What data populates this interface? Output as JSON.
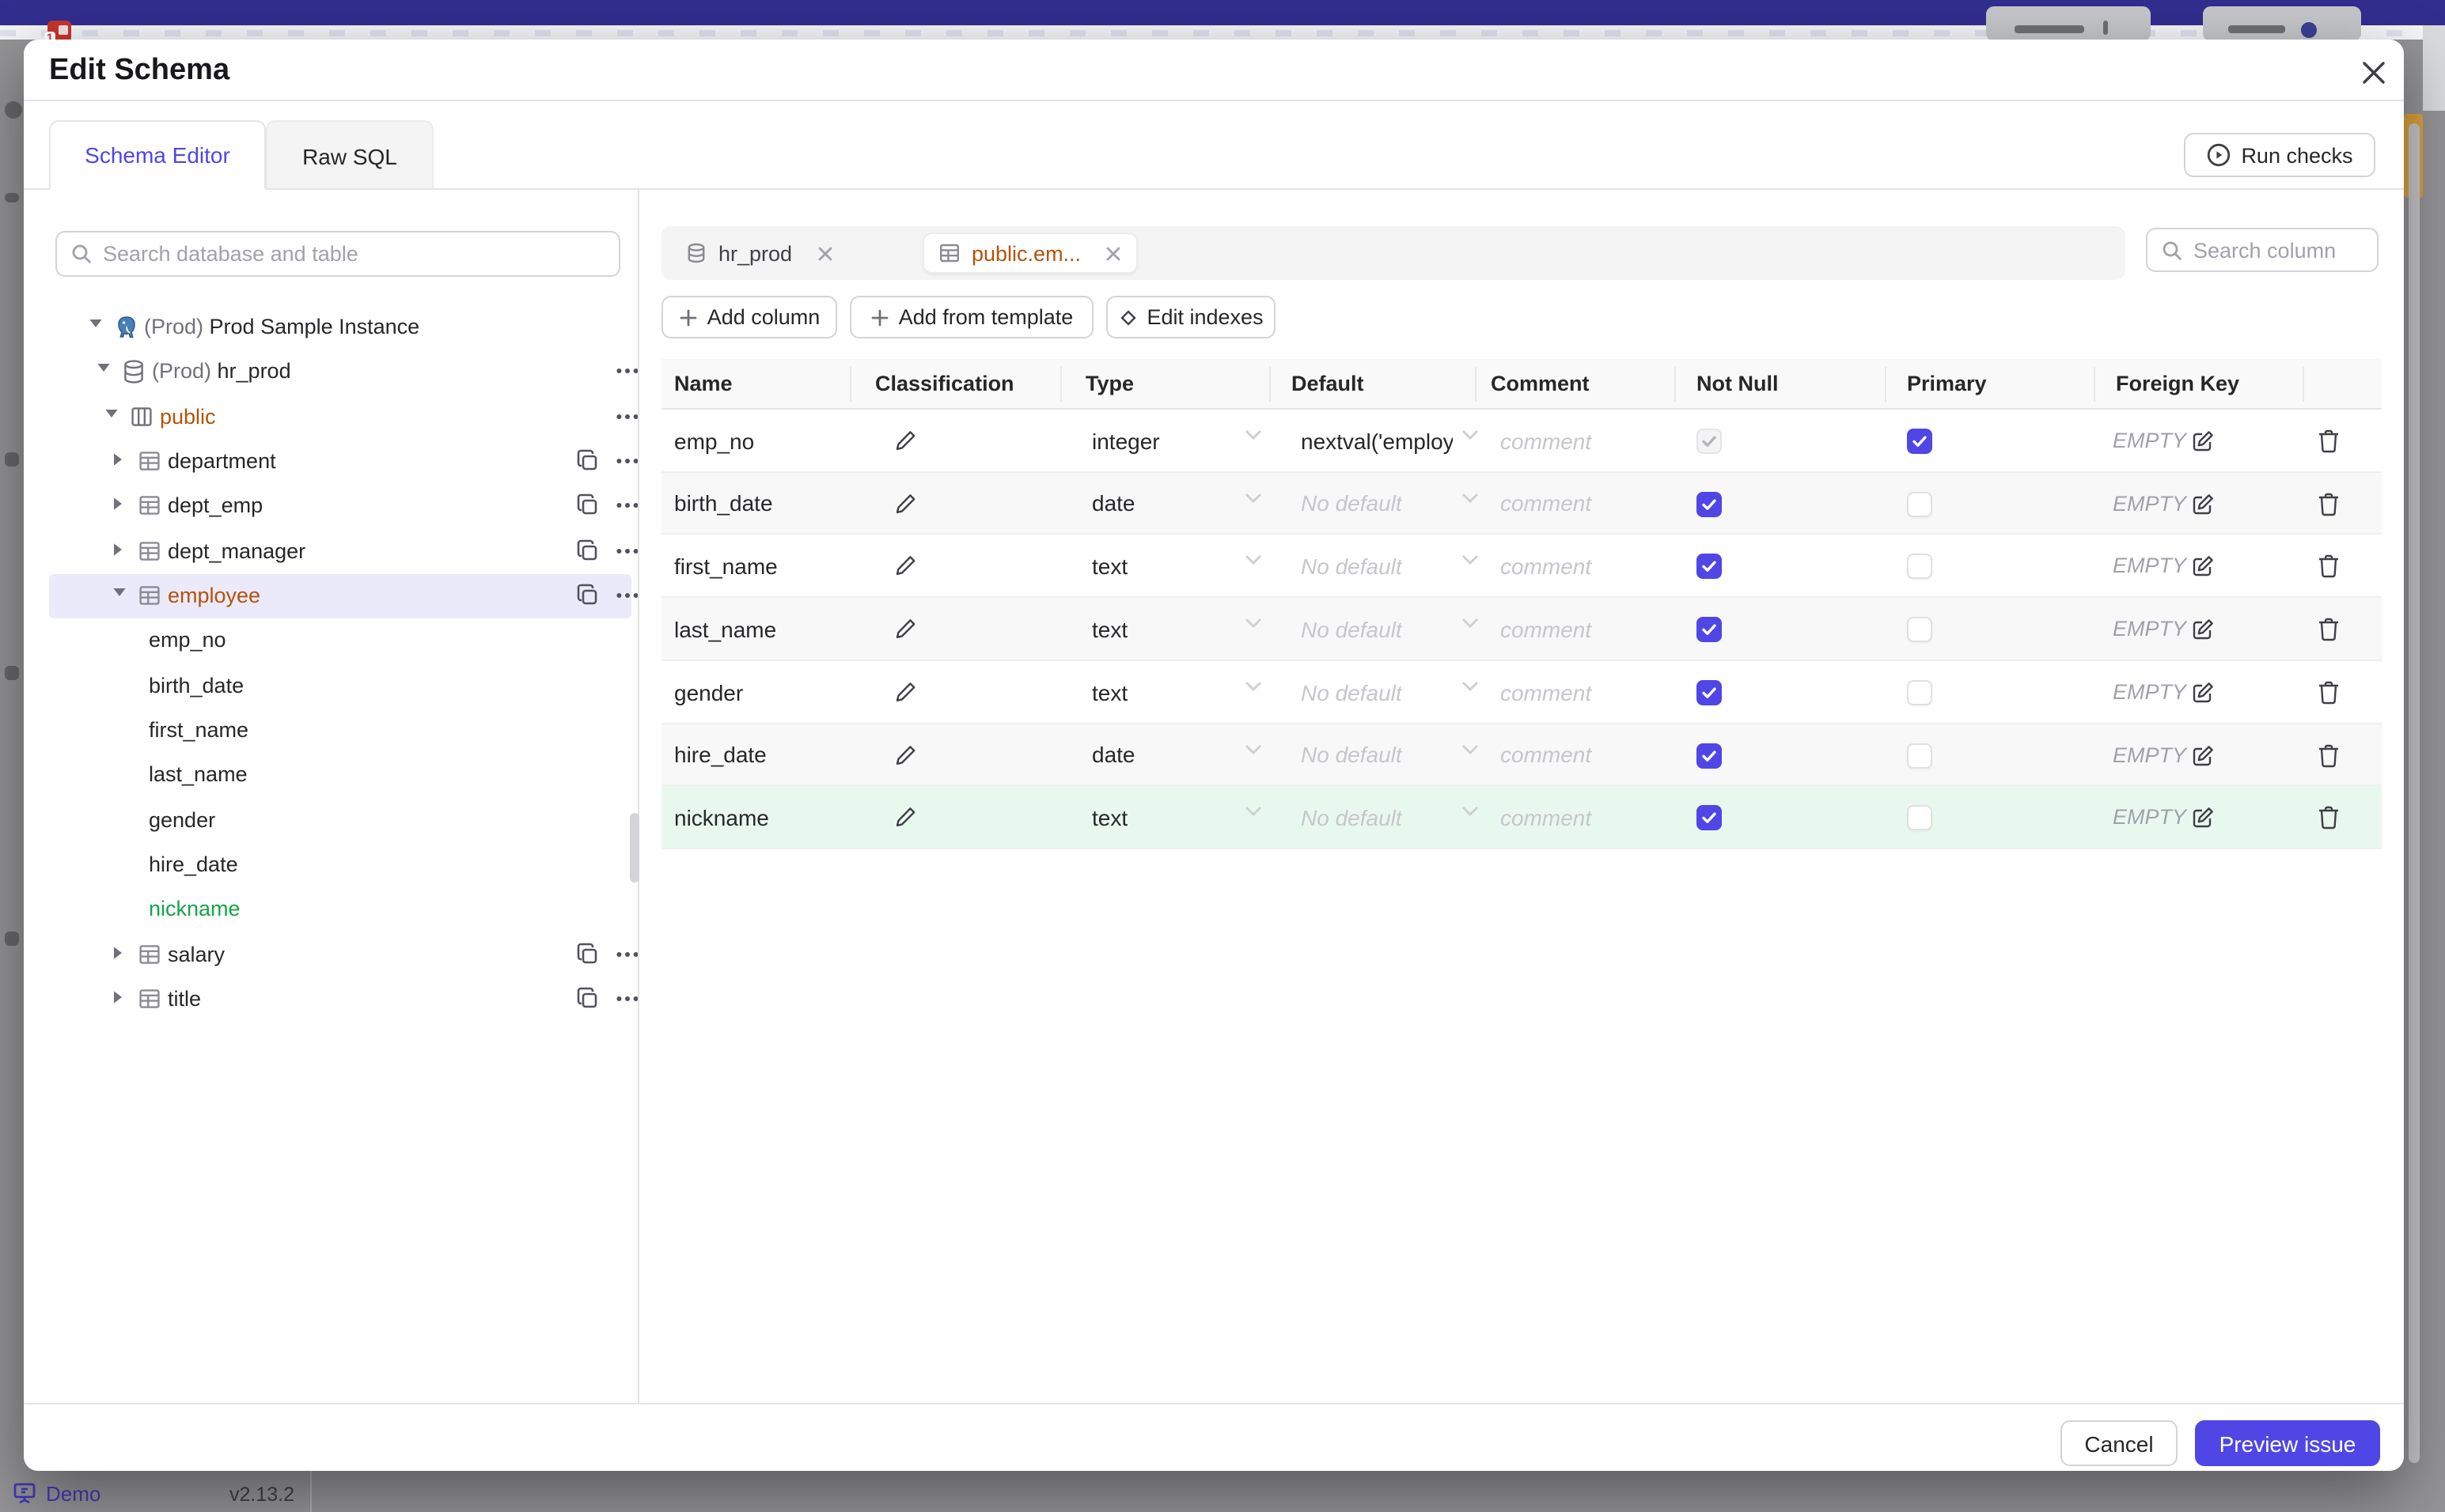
{
  "colors": {
    "accent": "#4f46e5",
    "topbar": "#312e8f",
    "amber": "#b45309",
    "green": "#16a34a",
    "selected_row_bg": "#ebeafb",
    "green_row_bg": "#e9f8ef"
  },
  "modal": {
    "title": "Edit Schema",
    "close_icon": "close-icon"
  },
  "tabs": {
    "schema_editor": "Schema Editor",
    "raw_sql": "Raw SQL"
  },
  "toolbar": {
    "run_checks": "Run checks",
    "add_column": "Add column",
    "add_from_template": "Add from template",
    "edit_indexes": "Edit indexes"
  },
  "sidebar": {
    "search_placeholder": "Search database and table",
    "tree": [
      {
        "level": 0,
        "icon": "postgres-icon",
        "caret": "down",
        "prefix": "(Prod) ",
        "label": "Prod Sample Instance",
        "actions": []
      },
      {
        "level": 1,
        "icon": "database-icon",
        "caret": "down",
        "prefix": "(Prod) ",
        "label": "hr_prod",
        "actions": [
          "more"
        ]
      },
      {
        "level": 2,
        "icon": "schema-icon",
        "caret": "down",
        "prefix": "",
        "label": "public",
        "color": "amber",
        "actions": [
          "more"
        ]
      },
      {
        "level": 3,
        "icon": "table-icon",
        "caret": "right",
        "prefix": "",
        "label": "department",
        "actions": [
          "copy",
          "more"
        ]
      },
      {
        "level": 3,
        "icon": "table-icon",
        "caret": "right",
        "prefix": "",
        "label": "dept_emp",
        "actions": [
          "copy",
          "more"
        ]
      },
      {
        "level": 3,
        "icon": "table-icon",
        "caret": "right",
        "prefix": "",
        "label": "dept_manager",
        "actions": [
          "copy",
          "more"
        ]
      },
      {
        "level": 3,
        "icon": "table-icon",
        "caret": "down",
        "prefix": "",
        "label": "employee",
        "color": "amber",
        "selected": true,
        "actions": [
          "copy",
          "more"
        ]
      },
      {
        "level": 4,
        "icon": "",
        "caret": "",
        "prefix": "",
        "label": "emp_no",
        "actions": []
      },
      {
        "level": 4,
        "icon": "",
        "caret": "",
        "prefix": "",
        "label": "birth_date",
        "actions": []
      },
      {
        "level": 4,
        "icon": "",
        "caret": "",
        "prefix": "",
        "label": "first_name",
        "actions": []
      },
      {
        "level": 4,
        "icon": "",
        "caret": "",
        "prefix": "",
        "label": "last_name",
        "actions": []
      },
      {
        "level": 4,
        "icon": "",
        "caret": "",
        "prefix": "",
        "label": "gender",
        "actions": []
      },
      {
        "level": 4,
        "icon": "",
        "caret": "",
        "prefix": "",
        "label": "hire_date",
        "actions": []
      },
      {
        "level": 4,
        "icon": "",
        "caret": "",
        "prefix": "",
        "label": "nickname",
        "color": "green",
        "actions": []
      },
      {
        "level": 3,
        "icon": "table-icon",
        "caret": "right",
        "prefix": "",
        "label": "salary",
        "actions": [
          "copy",
          "more"
        ]
      },
      {
        "level": 3,
        "icon": "table-icon",
        "caret": "right",
        "prefix": "",
        "label": "title",
        "actions": [
          "copy",
          "more"
        ]
      }
    ]
  },
  "main": {
    "chips": [
      {
        "icon": "database-icon",
        "label": "hr_prod",
        "active": false
      },
      {
        "icon": "table-icon",
        "label": "public.em...",
        "active": true,
        "color": "amber"
      }
    ],
    "search_placeholder": "Search column",
    "table": {
      "headers": [
        "Name",
        "Classification",
        "Type",
        "Default",
        "Comment",
        "Not Null",
        "Primary",
        "Foreign Key"
      ],
      "comment_placeholder": "comment",
      "default_placeholder": "No default",
      "foreign_key_empty": "EMPTY",
      "rows": [
        {
          "name": "emp_no",
          "type": "integer",
          "default": "nextval('employ",
          "not_null": "disabled-checked",
          "primary": true,
          "highlight": ""
        },
        {
          "name": "birth_date",
          "type": "date",
          "default": "",
          "not_null": "checked",
          "primary": false,
          "highlight": ""
        },
        {
          "name": "first_name",
          "type": "text",
          "default": "",
          "not_null": "checked",
          "primary": false,
          "highlight": ""
        },
        {
          "name": "last_name",
          "type": "text",
          "default": "",
          "not_null": "checked",
          "primary": false,
          "highlight": ""
        },
        {
          "name": "gender",
          "type": "text",
          "default": "",
          "not_null": "checked",
          "primary": false,
          "highlight": ""
        },
        {
          "name": "hire_date",
          "type": "date",
          "default": "",
          "not_null": "checked",
          "primary": false,
          "highlight": ""
        },
        {
          "name": "nickname",
          "type": "text",
          "default": "",
          "not_null": "checked",
          "primary": false,
          "highlight": "green"
        }
      ]
    }
  },
  "footer": {
    "cancel": "Cancel",
    "preview_issue": "Preview issue"
  },
  "backdrop": {
    "demo_label": "Demo",
    "version": "v2.13.2"
  }
}
